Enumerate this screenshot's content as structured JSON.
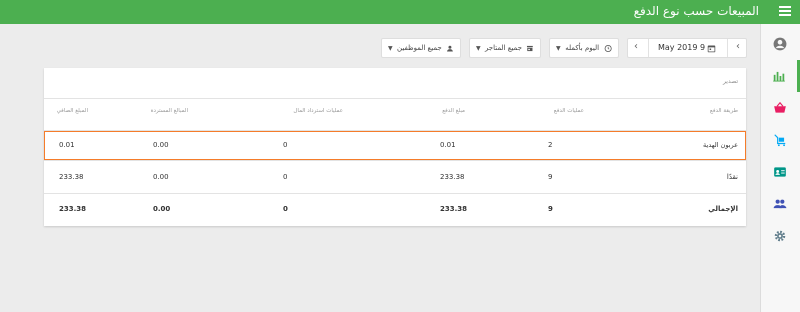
{
  "header": {
    "title": "المبيعات حسب نوع الدفع"
  },
  "filters": {
    "employees": "جميع الموظفين",
    "stores": "جميع المتاجر",
    "time": "اليوم بأكمله",
    "date": "May 2019 9"
  },
  "card": {
    "export": "تصدير"
  },
  "table": {
    "columns": [
      "طريقة الدفع",
      "عمليات الدفع",
      "مبلغ الدفع",
      "عمليات استرداد المال",
      "المبالغ المستردة",
      "المبلغ الصافي"
    ],
    "rows": [
      [
        "عربون الهدية",
        "2",
        "0.01",
        "0",
        "0.00",
        "0.01"
      ],
      [
        "نقدًا",
        "9",
        "233.38",
        "0",
        "0.00",
        "233.38"
      ]
    ],
    "total": [
      "الإجمالي",
      "9",
      "233.38",
      "0",
      "0.00",
      "233.38"
    ]
  },
  "sidebar": {
    "items": [
      "account-icon",
      "reports-icon",
      "basket-icon",
      "items-icon",
      "employee-card-icon",
      "customers-icon",
      "settings-icon"
    ],
    "active": "reports-icon"
  },
  "colors": {
    "accent": "#4caf50",
    "highlight": "#f57c2a"
  }
}
